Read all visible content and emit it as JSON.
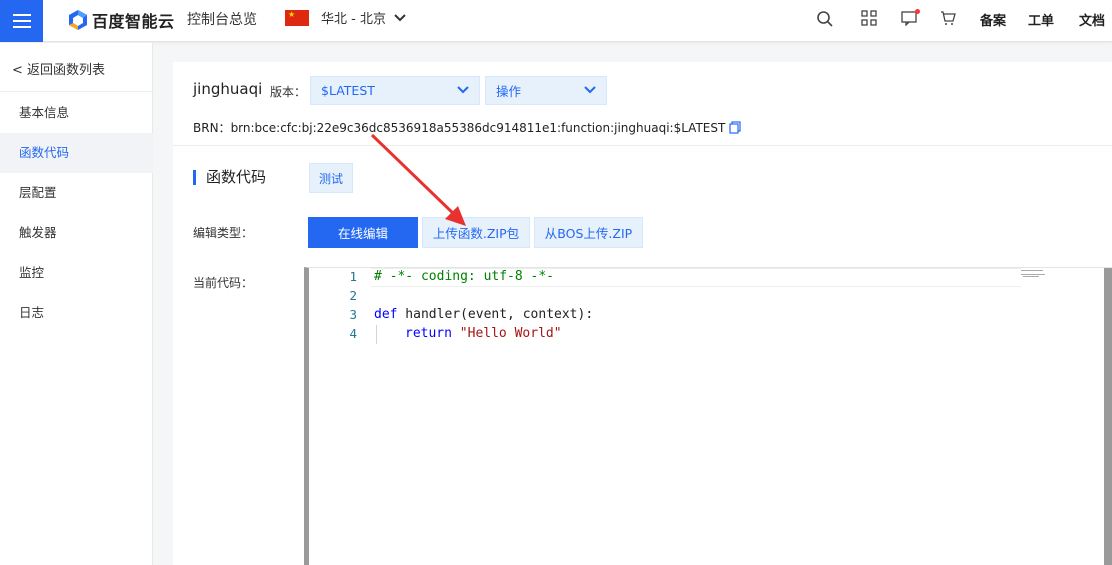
{
  "header": {
    "brand": "百度智能云",
    "console_link": "控制台总览",
    "region": "华北 - 北京",
    "links": [
      "备案",
      "工单",
      "文档"
    ],
    "icons": [
      "menu-icon",
      "search-icon",
      "grid-icon",
      "message-icon",
      "cart-icon"
    ]
  },
  "sidebar": {
    "back_link": "< 返回函数列表",
    "items": [
      {
        "label": "基本信息",
        "active": false
      },
      {
        "label": "函数代码",
        "active": true
      },
      {
        "label": "层配置",
        "active": false
      },
      {
        "label": "触发器",
        "active": false
      },
      {
        "label": "监控",
        "active": false
      },
      {
        "label": "日志",
        "active": false
      }
    ]
  },
  "function": {
    "name": "jinghuaqi",
    "version_label": "版本：",
    "version_value": "$LATEST",
    "action_label": "操作",
    "brn_label": "BRN：",
    "brn_value": "brn:bce:cfc:bj:22e9c36dc8536918a55386dc914811e1:function:jinghuaqi:$LATEST"
  },
  "code_section": {
    "title": "函数代码",
    "test_button": "测试",
    "edit_type_label": "编辑类型：",
    "edit_types": [
      "在线编辑",
      "上传函数.ZIP包",
      "从BOS上传.ZIP"
    ],
    "active_edit_type": 0,
    "current_code_label": "当前代码："
  },
  "editor": {
    "line_numbers": [
      "1",
      "2",
      "3",
      "4"
    ],
    "line1": "# -*- coding: utf-8 -*-",
    "line3_kw": "def",
    "line3_rest": " handler(event, context):",
    "line4_kw": "return",
    "line4_str": "\"Hello World\""
  },
  "colors": {
    "accent": "#2468f2",
    "annotation_arrow": "#e8322f"
  }
}
